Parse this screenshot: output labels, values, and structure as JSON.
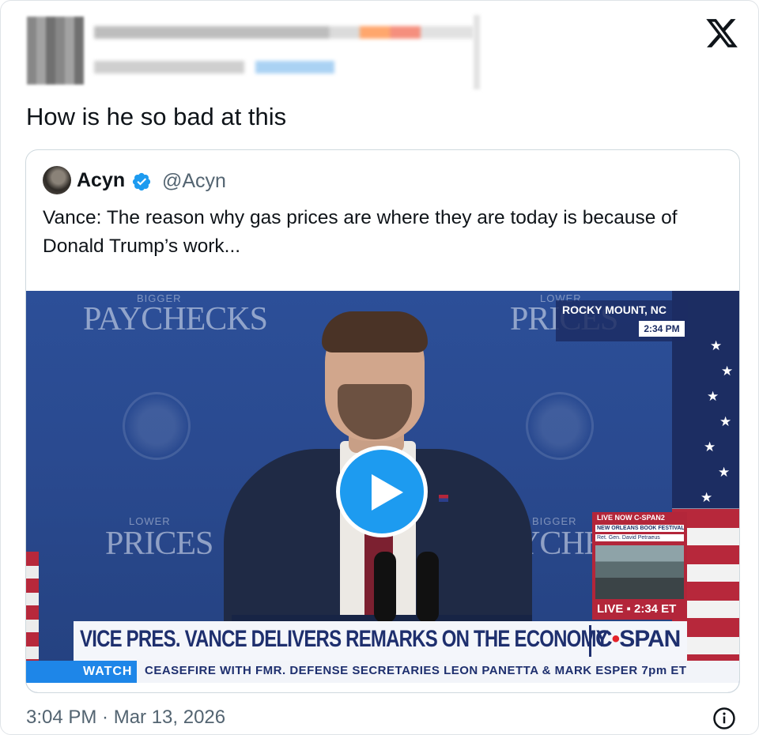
{
  "post": {
    "text": "How is he so bad at this",
    "timestamp": "3:04 PM · Mar 13, 2026"
  },
  "quoted": {
    "name": "Acyn",
    "handle": "@Acyn",
    "text": "Vance: The reason why gas prices are where they are today is because of Donald Trump’s work..."
  },
  "video": {
    "backdrop_top_left_small": "BIGGER",
    "backdrop_top_left": "PAYCHECKS",
    "backdrop_top_right_small": "LOWER",
    "backdrop_top_right": "PRICES",
    "backdrop_mid_left_small": "LOWER",
    "backdrop_mid_left": "PRICES",
    "backdrop_mid_right_small": "BIGGER",
    "backdrop_mid_right": "YCHEC",
    "location": "ROCKY MOUNT, NC",
    "location_time": "2:34 PM",
    "pip_header": "LIVE NOW C-SPAN2",
    "pip_event": "NEW ORLEANS BOOK FESTIVAL",
    "pip_guest": "Ret. Gen. David Petraeus",
    "pip_live": "LIVE ▪ 2:34 ET",
    "headline": "VICE PRES. VANCE DELIVERS REMARKS ON THE ECONOMY",
    "network_a": "C",
    "network_dot": "•",
    "network_b": "SPAN",
    "ticker_label": "WATCH",
    "ticker_text": "CEASEFIRE WITH FMR. DEFENSE SECRETARIES LEON PANETTA & MARK ESPER  7pm ET"
  },
  "icons": {
    "close": "x-logo-icon",
    "verified": "verified-badge-icon",
    "play": "play-icon",
    "info": "info-icon"
  },
  "colors": {
    "accent": "#1d9bf0",
    "cspan_navy": "#1e2f6e",
    "secondary_text": "#536471"
  }
}
